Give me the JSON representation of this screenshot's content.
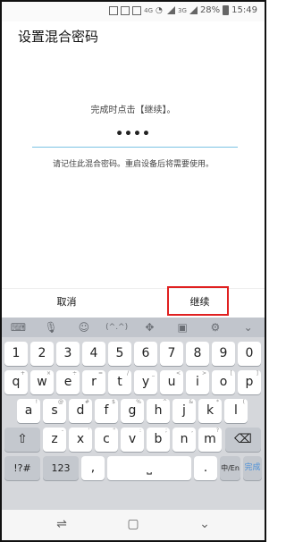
{
  "status_bar": {
    "battery": "28%",
    "time": "15:49",
    "net_labels": [
      "4G",
      "3G"
    ]
  },
  "header": {
    "title": "设置混合密码"
  },
  "content": {
    "instruction": "完成时点击【继续】。",
    "password_mask": "••••",
    "hint": "请记住此混合密码。重启设备后将需要使用。"
  },
  "actions": {
    "cancel": "取消",
    "continue": "继续"
  },
  "keyboard": {
    "toolbar_icons": [
      "keyboard-icon",
      "mic-icon",
      "emoji-icon",
      "kaomoji-icon",
      "move-cursor-icon",
      "clipboard-icon",
      "settings-icon",
      "chevron-down-icon"
    ],
    "toolbar_kaomoji": "(^.^)",
    "row_numbers": [
      "1",
      "2",
      "3",
      "4",
      "5",
      "6",
      "7",
      "8",
      "9",
      "0"
    ],
    "row_q": [
      "q",
      "w",
      "e",
      "r",
      "t",
      "y",
      "u",
      "i",
      "o",
      "p"
    ],
    "row_a": [
      "a",
      "s",
      "d",
      "f",
      "g",
      "h",
      "j",
      "k",
      "l"
    ],
    "row_z": [
      "z",
      "x",
      "c",
      "v",
      "b",
      "n",
      "m"
    ],
    "row_q_hints": [
      "+",
      "×",
      "÷",
      "=",
      "/",
      "_",
      "<",
      ">",
      "[",
      "]"
    ],
    "row_a_hints": [
      "!",
      "@",
      "#",
      "$",
      "%",
      "^",
      "&",
      "*",
      "("
    ],
    "row_z_hints": [
      "-",
      "'",
      "\"",
      ":",
      ";",
      ",",
      "?"
    ],
    "symbols": "!?#",
    "numbers": "123",
    "comma": ",",
    "period": ".",
    "lang": "中/En",
    "done": "完成"
  }
}
